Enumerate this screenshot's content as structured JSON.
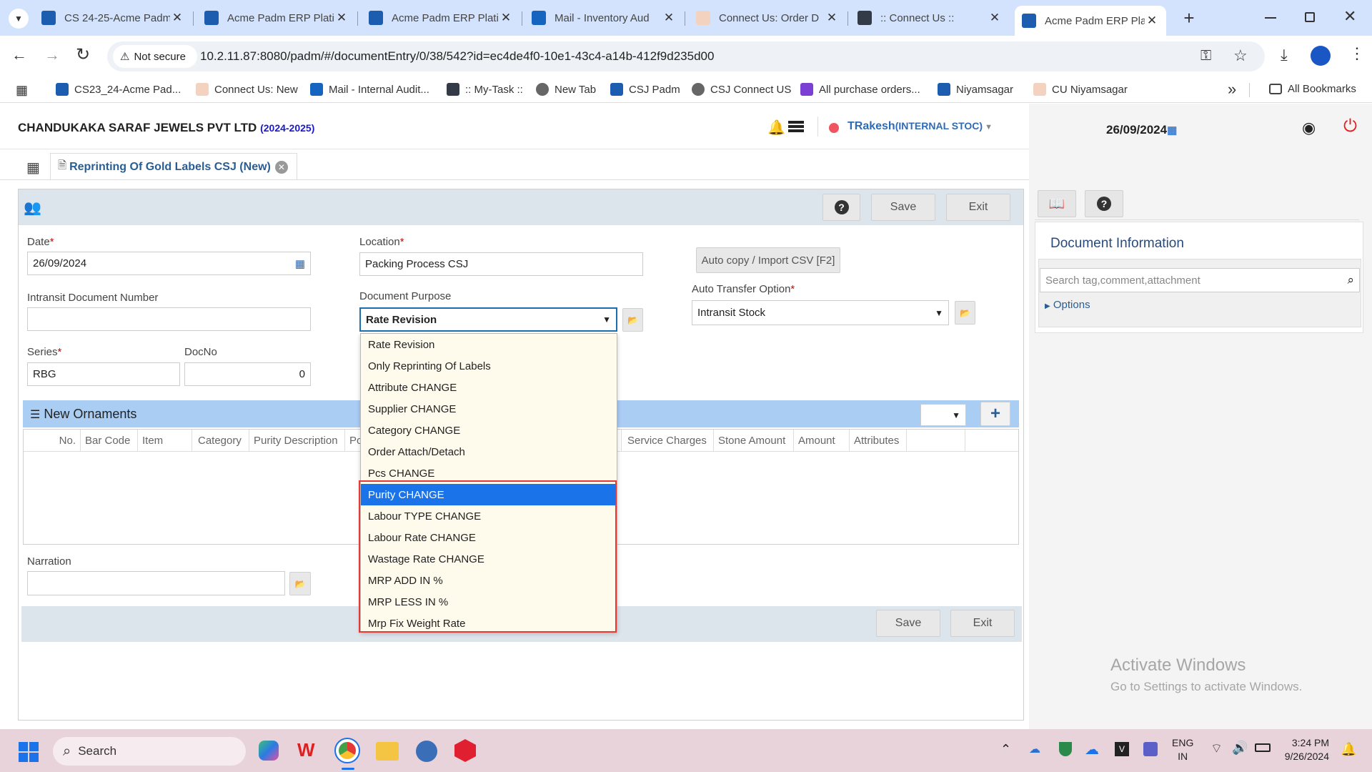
{
  "browser": {
    "tabs": [
      {
        "title": "CS 24-25-Acme Padm",
        "fav": "#1c5db0"
      },
      {
        "title": "Acme Padm ERP Plati",
        "fav": "#1c5db0"
      },
      {
        "title": "Acme Padm ERP Plati",
        "fav": "#1c5db0"
      },
      {
        "title": "Mail - Inventory Aud",
        "fav": "#1565c0"
      },
      {
        "title": "Connect Us: Order D",
        "fav": "#e8702a"
      },
      {
        "title": ":: Connect Us ::",
        "fav": "#333a48"
      },
      {
        "title": "Acme Padm ERP Plati",
        "fav": "#1c5db0"
      }
    ],
    "new_tab": "+",
    "not_secure": "Not secure",
    "url": "10.2.11.87:8080/padm/#/documentEntry/0/38/542?id=ec4de4f0-10e1-43c4-a14b-412f9d235d00",
    "bookmarks": [
      "CS23_24-Acme Pad...",
      "Connect Us: New",
      "Mail - Internal Audit...",
      ":: My-Task ::",
      "New Tab",
      "CSJ Padm",
      "CSJ Connect US",
      "All purchase orders...",
      "Niyamsagar",
      "CU Niyamsagar"
    ],
    "all_bookmarks": "All Bookmarks",
    "overflow": "»"
  },
  "app": {
    "company": "CHANDUKAKA SARAF JEWELS PVT LTD",
    "year": "(2024-2025)",
    "user": "TRakesh",
    "user_role": "(INTERNAL STOC)",
    "date": "26/09/2024",
    "doc_tab": "Reprinting Of Gold Labels CSJ (New)",
    "save": "Save",
    "exit": "Exit",
    "help": "?"
  },
  "form": {
    "date_label": "Date",
    "date_value": "26/09/2024",
    "location_label": "Location",
    "location_value": "Packing Process CSJ",
    "autocopy": "Auto copy / Import CSV [F2]",
    "intransit_label": "Intransit Document Number",
    "intransit_value": "",
    "purpose_label": "Document Purpose",
    "purpose_value": "Rate Revision",
    "auto_transfer_label": "Auto Transfer Option",
    "auto_transfer_value": "Intransit Stock",
    "series_label": "Series",
    "series_value": "RBG",
    "docno_label": "DocNo",
    "docno_value": "0",
    "narration_label": "Narration",
    "narration_value": "",
    "required": "*"
  },
  "dropdown": {
    "options": [
      "Rate Revision",
      "Only Reprinting Of Labels",
      "Attribute CHANGE",
      "Supplier CHANGE",
      "Category CHANGE",
      "Order Attach/Detach",
      "Pcs CHANGE",
      "Purity CHANGE",
      "Labour TYPE CHANGE",
      "Labour Rate CHANGE",
      "Wastage Rate CHANGE",
      "MRP ADD IN %",
      "MRP LESS IN %",
      "Mrp Fix Weight Rate"
    ],
    "highlighted_index": 7,
    "highlight_color": "#1a73e8",
    "box_color": "#e53935"
  },
  "grid": {
    "title": "New Ornaments",
    "add": "+",
    "columns_left": [
      "No.",
      "Bar Code",
      "Item",
      "Category",
      "Purity Description",
      "Po"
    ],
    "columns_right": [
      "Service Charges",
      "Stone Amount",
      "Amount",
      "Attributes"
    ]
  },
  "side": {
    "doc_info": "Document Information",
    "search_placeholder": "Search tag,comment,attachment",
    "options": "Options",
    "activate_title": "Activate Windows",
    "activate_sub": "Go to Settings to activate Windows."
  },
  "taskbar": {
    "search": "Search",
    "lang1": "ENG",
    "lang2": "IN",
    "time": "3:24 PM",
    "date": "9/26/2024"
  }
}
